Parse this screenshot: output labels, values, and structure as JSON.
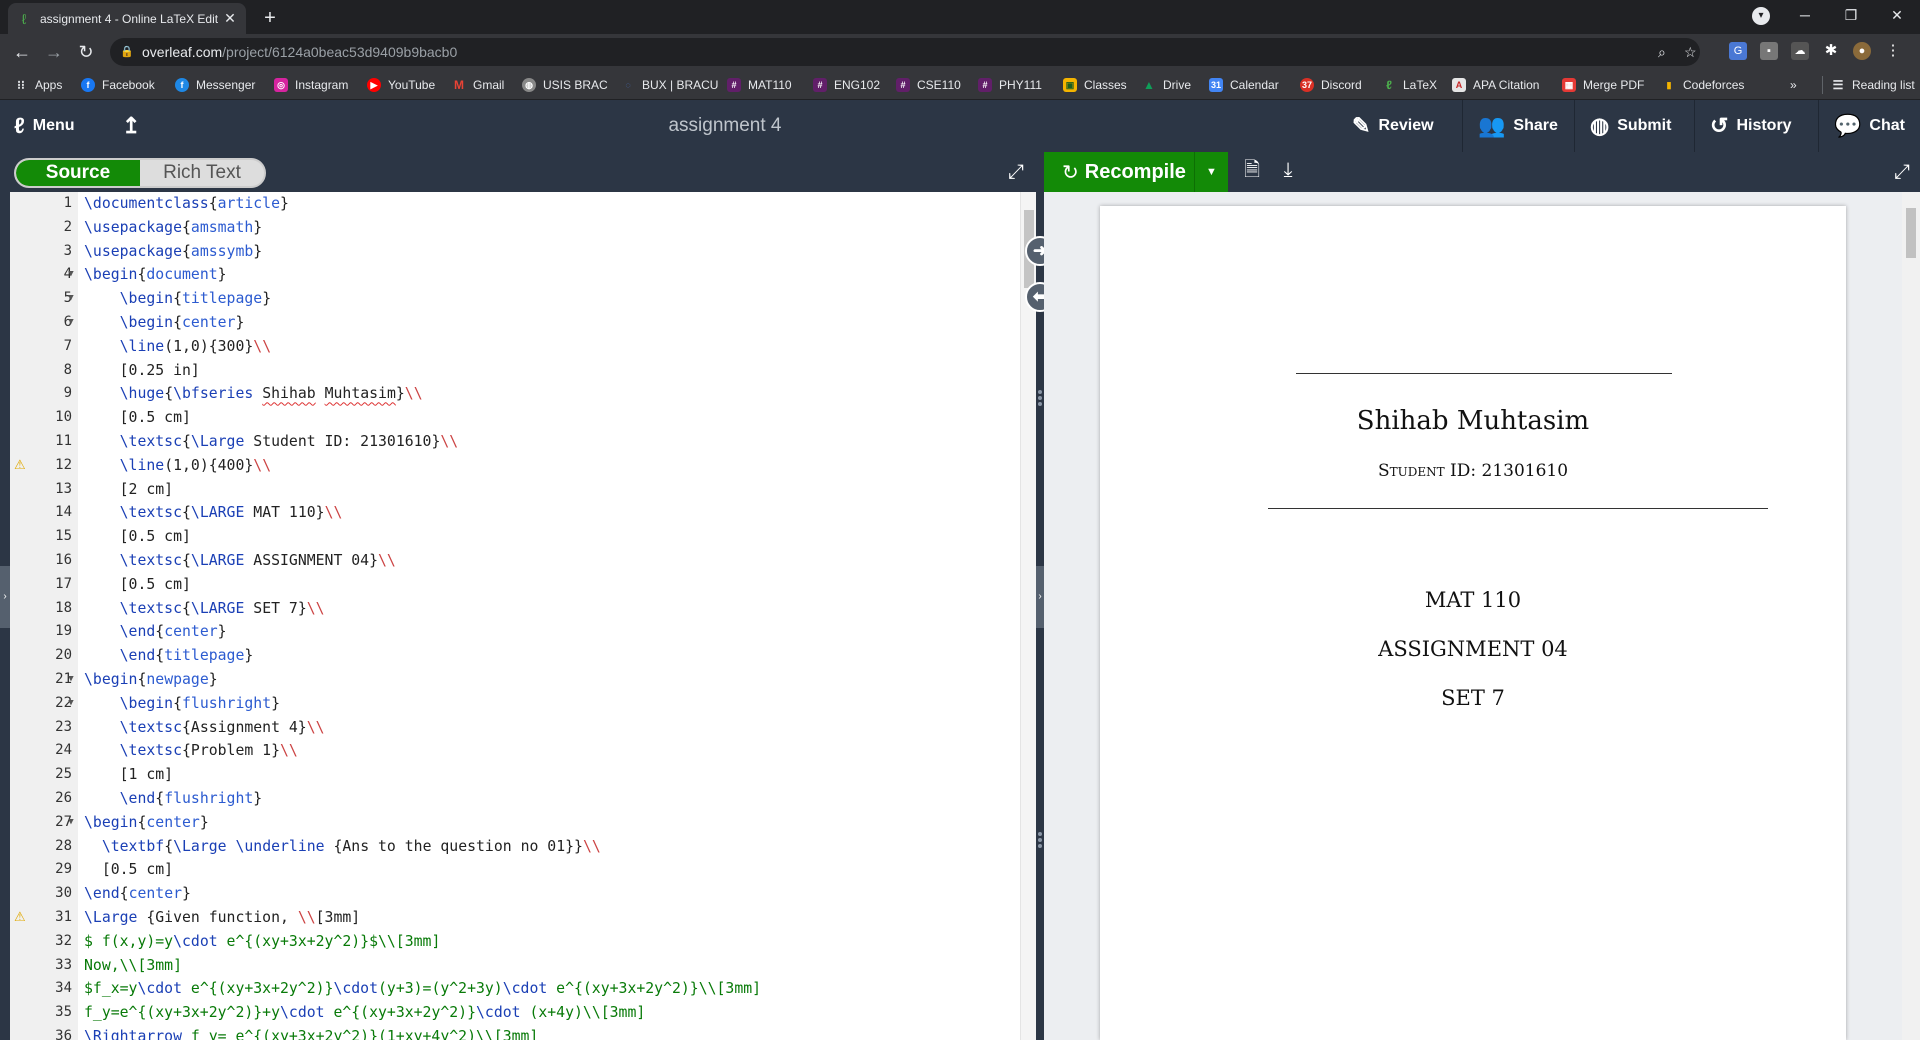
{
  "browser": {
    "tab_title": "assignment 4 - Online LaTeX Edit",
    "url_host": "overleaf.com",
    "url_path": "/project/6124a0beac53d9409b9bacb0",
    "bookmarks": [
      "Apps",
      "Facebook",
      "Messenger",
      "Instagram",
      "YouTube",
      "Gmail",
      "USIS BRAC",
      "BUX | BRACU",
      "MAT110",
      "ENG102",
      "CSE110",
      "PHY111",
      "Classes",
      "Drive",
      "Calendar",
      "Discord",
      "LaTeX",
      "APA Citation",
      "Merge PDF",
      "Codeforces"
    ],
    "reading_list": "Reading list",
    "more": "»"
  },
  "overleaf": {
    "menu": "Menu",
    "project_title": "assignment 4",
    "review": "Review",
    "share": "Share",
    "submit": "Submit",
    "history": "History",
    "chat": "Chat",
    "source_tab": "Source",
    "rich_text_tab": "Rich Text",
    "recompile": "Recompile"
  },
  "editor": {
    "lines": [
      {
        "n": "1",
        "fold": false,
        "warn": false
      },
      {
        "n": "2",
        "fold": false,
        "warn": false
      },
      {
        "n": "3",
        "fold": false,
        "warn": false
      },
      {
        "n": "4",
        "fold": true,
        "warn": false
      },
      {
        "n": "5",
        "fold": true,
        "warn": false
      },
      {
        "n": "6",
        "fold": true,
        "warn": false
      },
      {
        "n": "7",
        "fold": false,
        "warn": false
      },
      {
        "n": "8",
        "fold": false,
        "warn": false
      },
      {
        "n": "9",
        "fold": false,
        "warn": false
      },
      {
        "n": "10",
        "fold": false,
        "warn": false
      },
      {
        "n": "11",
        "fold": false,
        "warn": false
      },
      {
        "n": "12",
        "fold": false,
        "warn": true
      },
      {
        "n": "13",
        "fold": false,
        "warn": false
      },
      {
        "n": "14",
        "fold": false,
        "warn": false
      },
      {
        "n": "15",
        "fold": false,
        "warn": false
      },
      {
        "n": "16",
        "fold": false,
        "warn": false
      },
      {
        "n": "17",
        "fold": false,
        "warn": false
      },
      {
        "n": "18",
        "fold": false,
        "warn": false
      },
      {
        "n": "19",
        "fold": false,
        "warn": false
      },
      {
        "n": "20",
        "fold": false,
        "warn": false
      },
      {
        "n": "21",
        "fold": true,
        "warn": false
      },
      {
        "n": "22",
        "fold": true,
        "warn": false
      },
      {
        "n": "23",
        "fold": false,
        "warn": false
      },
      {
        "n": "24",
        "fold": false,
        "warn": false
      },
      {
        "n": "25",
        "fold": false,
        "warn": false
      },
      {
        "n": "26",
        "fold": false,
        "warn": false
      },
      {
        "n": "27",
        "fold": true,
        "warn": false
      },
      {
        "n": "28",
        "fold": false,
        "warn": false
      },
      {
        "n": "29",
        "fold": false,
        "warn": false
      },
      {
        "n": "30",
        "fold": false,
        "warn": false
      },
      {
        "n": "31",
        "fold": false,
        "warn": true
      },
      {
        "n": "32",
        "fold": false,
        "warn": false
      },
      {
        "n": "33",
        "fold": false,
        "warn": false
      },
      {
        "n": "34",
        "fold": false,
        "warn": false
      },
      {
        "n": "35",
        "fold": false,
        "warn": false
      },
      {
        "n": "36",
        "fold": false,
        "warn": false
      }
    ],
    "code": [
      "\\documentclass{article}",
      "\\usepackage{amsmath}",
      "\\usepackage{amssymb}",
      "\\begin{document}",
      "    \\begin{titlepage}",
      "    \\begin{center}",
      "    \\line(1,0){300}\\\\",
      "    [0.25 in]",
      "    \\huge{\\bfseries Shihab Muhtasim}\\\\",
      "    [0.5 cm]",
      "    \\textsc{\\Large Student ID: 21301610}\\\\",
      "    \\line(1,0){400}\\\\",
      "    [2 cm]",
      "    \\textsc{\\LARGE MAT 110}\\\\",
      "    [0.5 cm]",
      "    \\textsc{\\LARGE ASSIGNMENT 04}\\\\",
      "    [0.5 cm]",
      "    \\textsc{\\LARGE SET 7}\\\\",
      "    \\end{center}",
      "    \\end{titlepage}",
      "\\begin{newpage}",
      "    \\begin{flushright}",
      "    \\textsc{Assignment 4}\\\\",
      "    \\textsc{Problem 1}\\\\",
      "    [1 cm]",
      "    \\end{flushright}",
      "\\begin{center}",
      "  \\textbf{\\Large \\underline {Ans to the question no 01}}\\\\",
      "  [0.5 cm]",
      "\\end{center}",
      "\\Large {Given function, \\\\[3mm]",
      "$ f(x,y)=y\\cdot e^{(xy+3x+2y^2)}$\\\\[3mm]",
      "Now,\\\\[3mm]",
      "$f_x=y\\cdot e^{(xy+3x+2y^2)}\\cdot(y+3)=(y^2+3y)\\cdot e^{(xy+3x+2y^2)}\\\\[3mm]",
      "f_y=e^{(xy+3x+2y^2)}+y\\cdot e^{(xy+3x+2y^2)}\\cdot (x+4y)\\\\[3mm]",
      "\\Rightarrow f_y= e^{(xy+3x+2y^2)}(1+xy+4y^2)\\\\[3mm]"
    ]
  },
  "pdf": {
    "name": "Shihab Muhtasim",
    "student_id": "Student ID: 21301610",
    "course": "MAT 110",
    "assignment": "ASSIGNMENT 04",
    "set": "SET 7"
  },
  "colors": {
    "overleaf_bar": "#2c3645",
    "recompile_green": "#138a07",
    "latex_command": "#1a3fb5",
    "math_green": "#087a08"
  }
}
